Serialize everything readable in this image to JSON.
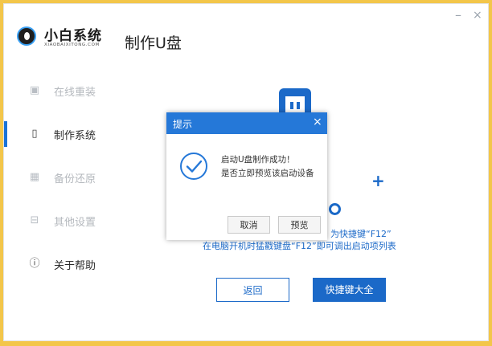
{
  "window": {
    "minimize_glyph": "–",
    "close_glyph": "×"
  },
  "logo": {
    "name": "小白系统",
    "subtitle": "XIAOBAIXITONG.COM",
    "icon": "logo-icon"
  },
  "page_title": "制作U盘",
  "sidebar": {
    "items": [
      {
        "label": "在线重装",
        "icon": "monitor-icon",
        "glyph": "▣",
        "state": "disabled"
      },
      {
        "label": "制作系统",
        "icon": "usb-icon",
        "glyph": "▯",
        "state": "active"
      },
      {
        "label": "备份还原",
        "icon": "grid-icon",
        "glyph": "▦",
        "state": "disabled"
      },
      {
        "label": "其他设置",
        "icon": "box-icon",
        "glyph": "⊟",
        "state": "disabled"
      },
      {
        "label": "关于帮助",
        "icon": "info-icon",
        "glyph": "ⓘ",
        "state": "normal"
      }
    ]
  },
  "main": {
    "hint_line1": "为快捷键“F12”",
    "hint_line2": "在电脑开机时猛戳键盘“F12”即可调出启动项列表",
    "back_button": "返回",
    "shortcut_button": "快捷键大全"
  },
  "dialog": {
    "title": "提示",
    "close_glyph": "×",
    "message_line1": "启动U盘制作成功！",
    "message_line2": "是否立即预览该启动设备",
    "cancel_button": "取消",
    "preview_button": "预览"
  },
  "colors": {
    "accent": "#1b69c8",
    "dialog_header": "#2578d8",
    "background": "#f3c64a"
  }
}
